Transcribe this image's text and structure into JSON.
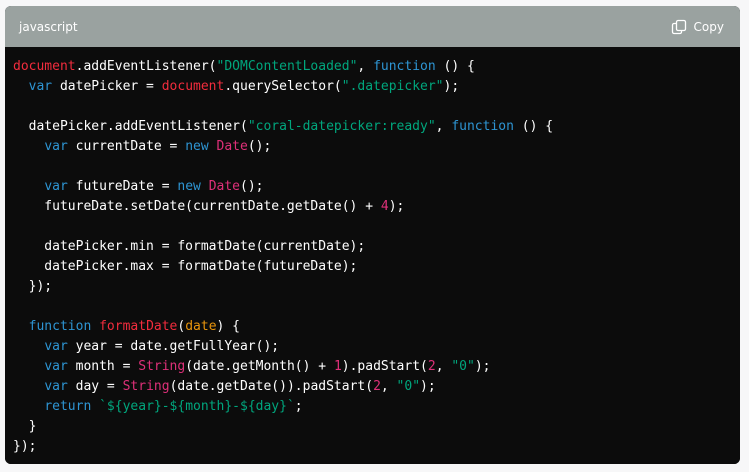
{
  "header": {
    "language": "javascript",
    "copy_label": "Copy"
  },
  "colors": {
    "keyword": "#2e95d3",
    "string": "#00a67d",
    "function": "#f22c3d",
    "number": "#df3079",
    "param": "#e9950c",
    "plain": "#ffffff",
    "header_bg": "#9aa2a0",
    "code_bg": "#0c0c0c"
  },
  "code": {
    "lines": [
      [
        [
          "document",
          "fn"
        ],
        [
          ".addEventListener(",
          "plain"
        ],
        [
          "\"DOMContentLoaded\"",
          "str"
        ],
        [
          ", ",
          "plain"
        ],
        [
          "function",
          "kw"
        ],
        [
          " () {",
          "plain"
        ]
      ],
      [
        [
          "  ",
          "plain"
        ],
        [
          "var",
          "kw"
        ],
        [
          " datePicker = ",
          "plain"
        ],
        [
          "document",
          "fn"
        ],
        [
          ".querySelector(",
          "plain"
        ],
        [
          "\".datepicker\"",
          "str"
        ],
        [
          ");",
          "plain"
        ]
      ],
      [
        [
          "",
          "plain"
        ]
      ],
      [
        [
          "  datePicker.addEventListener(",
          "plain"
        ],
        [
          "\"coral-datepicker:ready\"",
          "str"
        ],
        [
          ", ",
          "plain"
        ],
        [
          "function",
          "kw"
        ],
        [
          " () {",
          "plain"
        ]
      ],
      [
        [
          "    ",
          "plain"
        ],
        [
          "var",
          "kw"
        ],
        [
          " currentDate = ",
          "plain"
        ],
        [
          "new",
          "kw"
        ],
        [
          " ",
          "plain"
        ],
        [
          "Date",
          "class"
        ],
        [
          "();",
          "plain"
        ]
      ],
      [
        [
          "",
          "plain"
        ]
      ],
      [
        [
          "    ",
          "plain"
        ],
        [
          "var",
          "kw"
        ],
        [
          " futureDate = ",
          "plain"
        ],
        [
          "new",
          "kw"
        ],
        [
          " ",
          "plain"
        ],
        [
          "Date",
          "class"
        ],
        [
          "();",
          "plain"
        ]
      ],
      [
        [
          "    futureDate.setDate(currentDate.getDate() + ",
          "plain"
        ],
        [
          "4",
          "num"
        ],
        [
          ");",
          "plain"
        ]
      ],
      [
        [
          "",
          "plain"
        ]
      ],
      [
        [
          "    datePicker.min = formatDate(currentDate);",
          "plain"
        ]
      ],
      [
        [
          "    datePicker.max = formatDate(futureDate);",
          "plain"
        ]
      ],
      [
        [
          "  });",
          "plain"
        ]
      ],
      [
        [
          "",
          "plain"
        ]
      ],
      [
        [
          "  ",
          "plain"
        ],
        [
          "function",
          "kw"
        ],
        [
          " ",
          "plain"
        ],
        [
          "formatDate",
          "fnname"
        ],
        [
          "(",
          "plain"
        ],
        [
          "date",
          "param"
        ],
        [
          ") {",
          "plain"
        ]
      ],
      [
        [
          "    ",
          "plain"
        ],
        [
          "var",
          "kw"
        ],
        [
          " year = date.getFullYear();",
          "plain"
        ]
      ],
      [
        [
          "    ",
          "plain"
        ],
        [
          "var",
          "kw"
        ],
        [
          " month = ",
          "plain"
        ],
        [
          "String",
          "class"
        ],
        [
          "(date.getMonth() + ",
          "plain"
        ],
        [
          "1",
          "num"
        ],
        [
          ").padStart(",
          "plain"
        ],
        [
          "2",
          "num"
        ],
        [
          ", ",
          "plain"
        ],
        [
          "\"0\"",
          "str"
        ],
        [
          ");",
          "plain"
        ]
      ],
      [
        [
          "    ",
          "plain"
        ],
        [
          "var",
          "kw"
        ],
        [
          " day = ",
          "plain"
        ],
        [
          "String",
          "class"
        ],
        [
          "(date.getDate()).padStart(",
          "plain"
        ],
        [
          "2",
          "num"
        ],
        [
          ", ",
          "plain"
        ],
        [
          "\"0\"",
          "str"
        ],
        [
          ");",
          "plain"
        ]
      ],
      [
        [
          "    ",
          "plain"
        ],
        [
          "return",
          "kw"
        ],
        [
          " ",
          "plain"
        ],
        [
          "`${year}-${month}-${day}`",
          "tpl"
        ],
        [
          ";",
          "plain"
        ]
      ],
      [
        [
          "  }",
          "plain"
        ]
      ],
      [
        [
          "});",
          "plain"
        ]
      ]
    ]
  }
}
